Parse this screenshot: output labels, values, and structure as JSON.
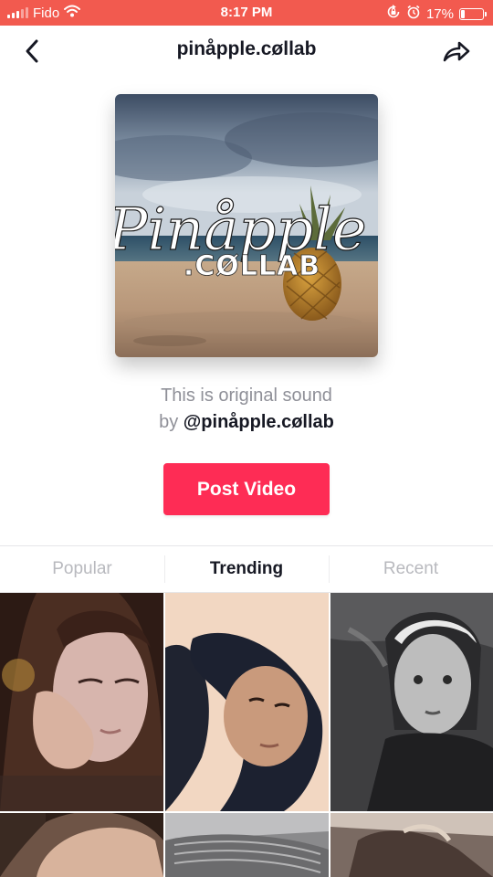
{
  "status_bar": {
    "carrier": "Fido",
    "time": "8:17 PM",
    "battery": "17%",
    "battery_level": 0.17,
    "icons": [
      "signal-icon",
      "wifi-icon",
      "orientation-lock-icon",
      "alarm-icon",
      "battery-icon"
    ]
  },
  "header": {
    "title": "pinåpple.cøllab",
    "back_icon": "chevron-left-icon",
    "share_icon": "share-arrow-icon"
  },
  "cover": {
    "logo_script": "Pinåpple",
    "logo_caps": ".CØLLAB"
  },
  "sound": {
    "description": "This is original sound",
    "by_prefix": "by ",
    "author": "@pinåpple.cøllab"
  },
  "post_button": {
    "label": "Post Video"
  },
  "tabs": [
    {
      "label": "Popular",
      "active": false
    },
    {
      "label": "Trending",
      "active": true
    },
    {
      "label": "Recent",
      "active": false
    }
  ],
  "colors": {
    "status_bar": "#f25a4f",
    "accent": "#fe2c55",
    "text_primary": "#161823",
    "text_secondary": "#8f9098",
    "tab_inactive": "#b8b9be"
  }
}
